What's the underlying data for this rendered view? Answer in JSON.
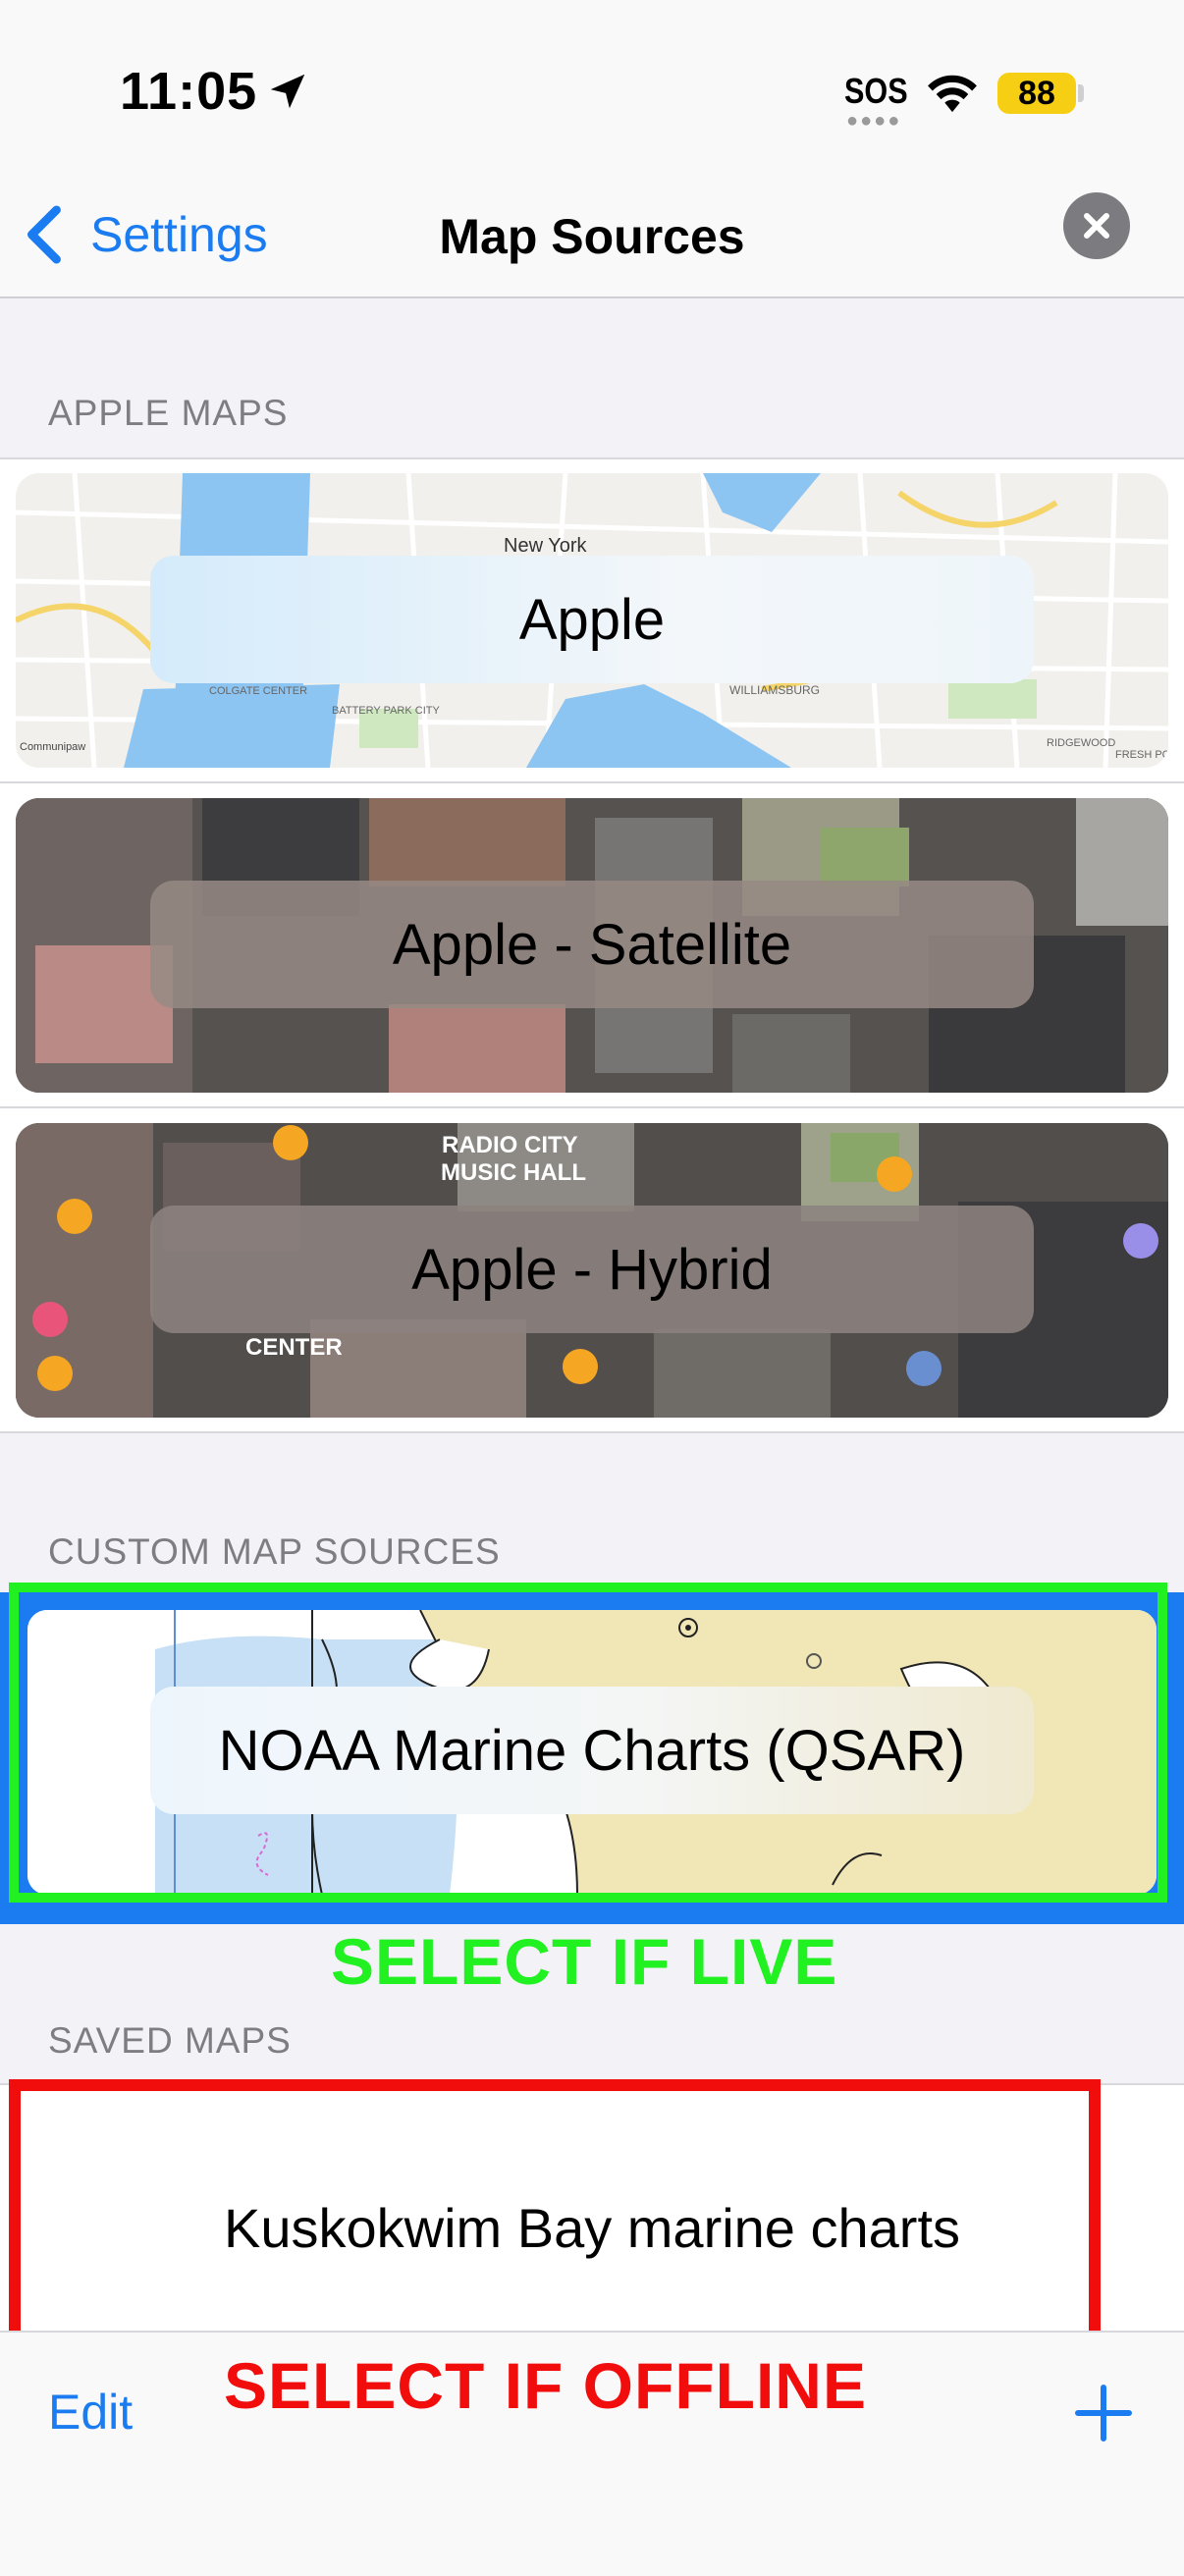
{
  "status_bar": {
    "time": "11:05",
    "sos": "SOS",
    "battery": "88",
    "icons": [
      "location-arrow-icon",
      "wifi-icon",
      "battery-icon"
    ]
  },
  "nav": {
    "back_label": "Settings",
    "title": "Map Sources",
    "close_icon": "close-icon"
  },
  "sections": {
    "apple_maps": "APPLE MAPS",
    "custom_map_sources": "CUSTOM MAP SOURCES",
    "saved_maps": "SAVED MAPS"
  },
  "apple_maps": [
    {
      "label": "Apple"
    },
    {
      "label": "Apple - Satellite"
    },
    {
      "label": "Apple - Hybrid"
    }
  ],
  "map_text": {
    "new_york": "New York",
    "williamsburg": "WILLIAMSBURG",
    "colgate_center": "COLGATE CENTER",
    "battery_park_city": "BATTERY PARK CITY",
    "ridgewood": "RIDGEWOOD",
    "fresh_pond": "FRESH POND",
    "communipaw": "Communipaw",
    "radio_city_1": "RADIO CITY",
    "radio_city_2": "MUSIC HALL",
    "center": "CENTER"
  },
  "custom_map_sources": [
    {
      "label": "NOAA Marine Charts (QSAR)",
      "selected": true
    }
  ],
  "saved_maps": [
    {
      "label": "Kuskokwim Bay marine charts"
    }
  ],
  "annotations": {
    "green": "SELECT IF LIVE",
    "red": "SELECT IF OFFLINE",
    "green_color": "#21f021",
    "red_color": "#f20d0d"
  },
  "toolbar": {
    "edit_label": "Edit",
    "add_icon": "plus-icon"
  },
  "colors": {
    "accent": "#1a7cf0",
    "background": "#f2f2f7"
  }
}
